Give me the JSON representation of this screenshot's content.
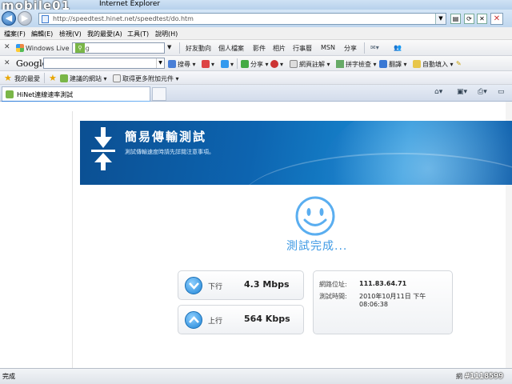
{
  "watermark": "mobile01",
  "window": {
    "title": "Internet Explorer"
  },
  "address": {
    "url": "http://speedtest.hinet.net/speedtest/do.htm"
  },
  "menu": [
    "檔案(F)",
    "編輯(E)",
    "檢視(V)",
    "我的最愛(A)",
    "工具(T)",
    "說明(H)"
  ],
  "toolbar1": {
    "windows_live": "Windows Live",
    "search_value": "Bing",
    "items": [
      "好友動向",
      "個人檔案",
      "影件",
      "相片",
      "行事曆",
      "MSN",
      "分享"
    ]
  },
  "toolbar2": {
    "brand": "Google",
    "items": [
      "搜尋",
      "分享",
      "網頁註解",
      "拼字檢查",
      "翻譯",
      "自動填入"
    ]
  },
  "favorites": {
    "label": "我的最愛",
    "items": [
      "建議的網站",
      "取得更多附加元件"
    ]
  },
  "tab": {
    "title": "HiNet連線速率測試"
  },
  "banner": {
    "title": "簡易傳輸測試",
    "subtitle": "測試傳輸速度時請先詳閱注意事項。"
  },
  "status_text": "測試完成...",
  "download": {
    "label": "下行",
    "value": "4.3 Mbps"
  },
  "upload": {
    "label": "上行",
    "value": "564 Kbps"
  },
  "info": {
    "ip_label": "網路位址:",
    "ip_value": "111.83.64.71",
    "time_label": "測試時間:",
    "time_value": "2010年10月11日 下午 08:06:38"
  },
  "statusbar": {
    "text": "完成",
    "zone": "網",
    "watermark": "#1118599"
  }
}
